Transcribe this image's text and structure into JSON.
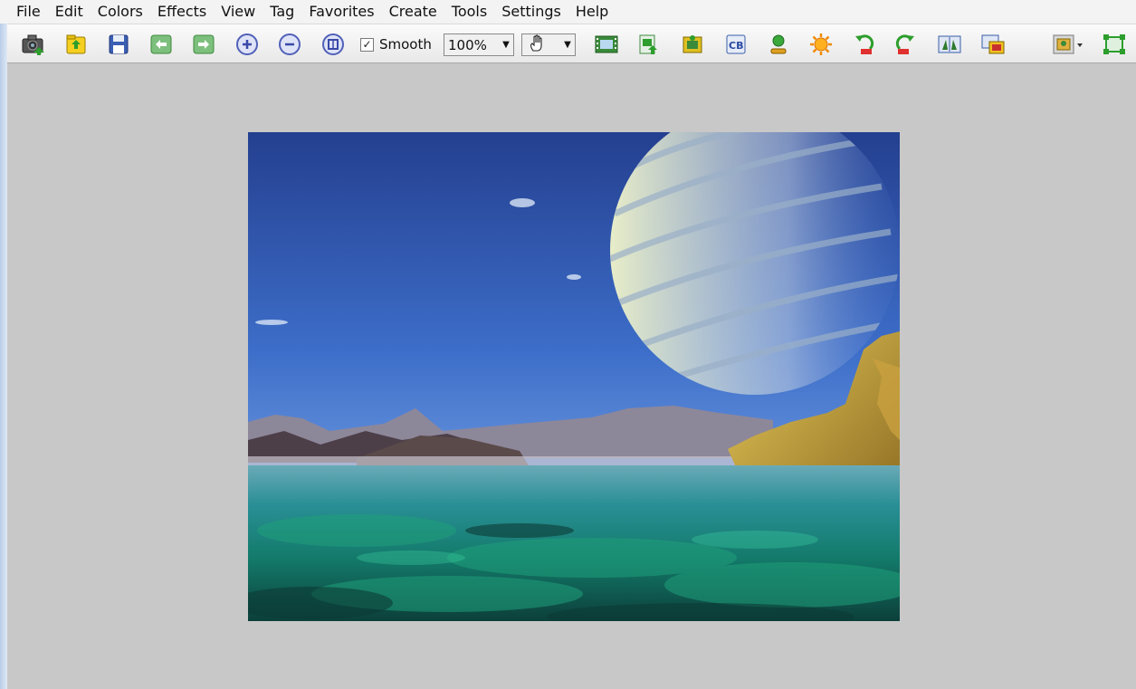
{
  "menu": [
    "File",
    "Edit",
    "Colors",
    "Effects",
    "View",
    "Tag",
    "Favorites",
    "Create",
    "Tools",
    "Settings",
    "Help"
  ],
  "toolbar": {
    "smooth_label": "Smooth",
    "smooth_checked": true,
    "zoom_value": "100%",
    "mouse_mode_icon": "hand-icon"
  },
  "colors": {
    "toolbar_bg": "#f0f0f0",
    "canvas_bg": "#c8c8c8",
    "accent_blue": "#3a5ea8"
  },
  "image": {
    "description_icon": "planet-landscape-image"
  }
}
